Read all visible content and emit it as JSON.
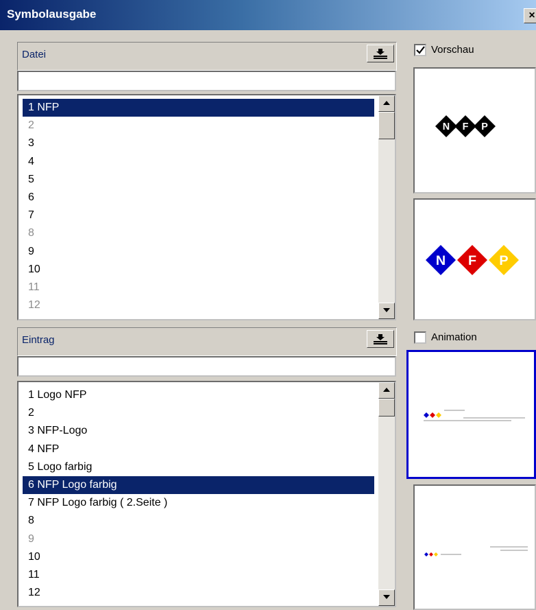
{
  "window": {
    "title": "Symbolausgabe",
    "close_glyph": "×"
  },
  "datei": {
    "label": "Datei",
    "input_value": "",
    "items": [
      {
        "label": "1 NFP",
        "selected": true,
        "enabled": true
      },
      {
        "label": "2",
        "enabled": false
      },
      {
        "label": "3",
        "enabled": true
      },
      {
        "label": "4",
        "enabled": true
      },
      {
        "label": "5",
        "enabled": true
      },
      {
        "label": "6",
        "enabled": true
      },
      {
        "label": "7",
        "enabled": true
      },
      {
        "label": "8",
        "enabled": false
      },
      {
        "label": "9",
        "enabled": true
      },
      {
        "label": "10",
        "enabled": true
      },
      {
        "label": "11",
        "enabled": false
      },
      {
        "label": "12",
        "enabled": false
      }
    ]
  },
  "eintrag": {
    "label": "Eintrag",
    "input_value": "",
    "items": [
      {
        "label": "1 Logo NFP",
        "enabled": true
      },
      {
        "label": "2",
        "enabled": true
      },
      {
        "label": "3 NFP-Logo",
        "enabled": true
      },
      {
        "label": "4 NFP",
        "enabled": true
      },
      {
        "label": "5 Logo farbig",
        "enabled": true
      },
      {
        "label": "6 NFP Logo farbig",
        "selected": true,
        "enabled": true
      },
      {
        "label": "7 NFP Logo farbig ( 2.Seite )",
        "enabled": true
      },
      {
        "label": "8",
        "enabled": true
      },
      {
        "label": "9",
        "enabled": false
      },
      {
        "label": "10",
        "enabled": true
      },
      {
        "label": "11",
        "enabled": true
      },
      {
        "label": "12",
        "enabled": true
      }
    ]
  },
  "options": {
    "vorschau": {
      "label": "Vorschau",
      "checked": true
    },
    "animation": {
      "label": "Animation",
      "checked": false
    }
  },
  "logo": {
    "letters": [
      "N",
      "F",
      "P"
    ],
    "colors": [
      "#0000cc",
      "#dd0000",
      "#ffcc00"
    ],
    "mono": "#000000"
  },
  "colors": {
    "selection": "#0a246a",
    "accent_border": "#0000cc",
    "face": "#d4d0c8"
  }
}
